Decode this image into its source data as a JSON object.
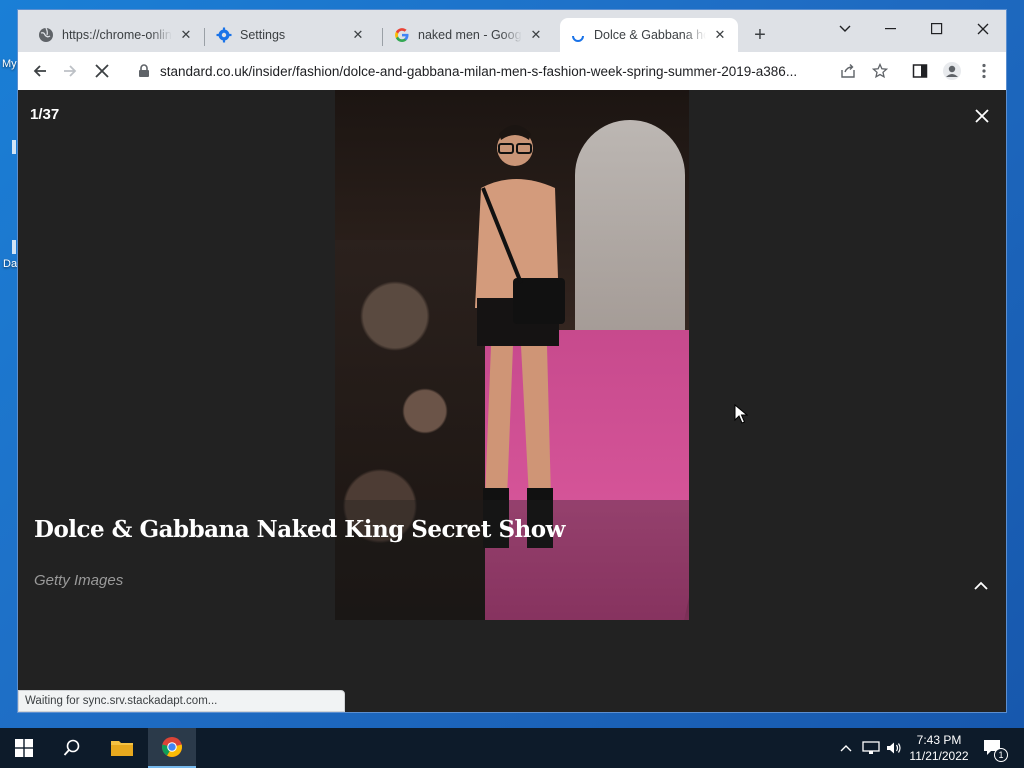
{
  "desktop": {
    "icon_text_1": "My",
    "icon_text_2": "Da"
  },
  "browser": {
    "tabs": [
      {
        "title": "https://chrome-online",
        "icon": "globe-icon",
        "active": false
      },
      {
        "title": "Settings",
        "icon": "gear-icon",
        "active": false
      },
      {
        "title": "naked men - Google",
        "icon": "google-icon",
        "active": false
      },
      {
        "title": "Dolce & Gabbana ho",
        "icon": "loading-spinner-icon",
        "active": true
      }
    ],
    "url": "standard.co.uk/insider/fashion/dolce-and-gabbana-milan-men-s-fashion-week-spring-summer-2019-a386...",
    "status_text": "Waiting for sync.srv.stackadapt.com..."
  },
  "gallery": {
    "counter": "1/37",
    "caption": "Dolce & Gabbana Naked King Secret Show",
    "credit": "Getty Images"
  },
  "taskbar": {
    "time": "7:43 PM",
    "date": "11/21/2022",
    "notification_count": "1"
  },
  "colors": {
    "accent": "#1a73e8",
    "page_bg": "#222222",
    "desktop_bg": "#1f6dc4"
  }
}
